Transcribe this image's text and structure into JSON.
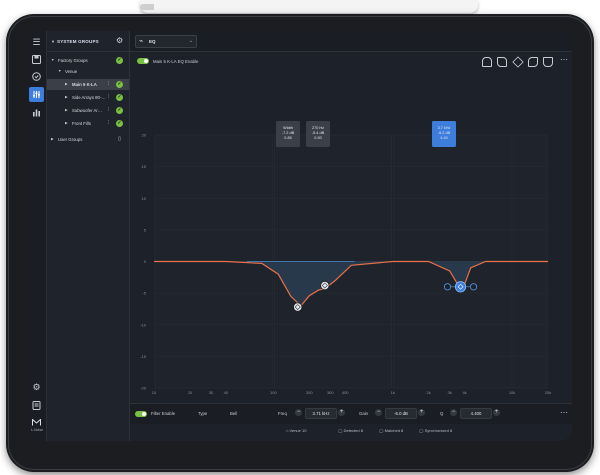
{
  "rail": {
    "bottom_label": "L-Noise"
  },
  "groups_panel": {
    "title": "SYSTEM GROUPS",
    "items": [
      {
        "label": "Factory Groups",
        "indent": 0,
        "expanded": true
      },
      {
        "label": "Venue",
        "indent": 1,
        "expanded": true
      },
      {
        "label": "Main 5 K-LA",
        "indent": 2,
        "selected": true
      },
      {
        "label": "Side Arrays 80-…",
        "indent": 2
      },
      {
        "label": "Subwoofer Ar…",
        "indent": 2
      },
      {
        "label": "Front Fills",
        "indent": 2
      },
      {
        "label": "User Groups",
        "indent": 0
      }
    ]
  },
  "topbar": {
    "selector_label": "EQ"
  },
  "eq_toggle_label": "Main 5 K-LA  EQ Enable",
  "filter_tags": [
    {
      "line1": "Width",
      "line2": "-7.2 dB",
      "line3": "0.85"
    },
    {
      "line1": "270 Hz",
      "line2": "-5.4 dB",
      "line3": "0.50"
    },
    {
      "line1": "3.7 kHz",
      "line2": "-6.2 dB",
      "line3": "4.40"
    }
  ],
  "chart_data": {
    "type": "line",
    "x_ticks": [
      "10",
      "20",
      "30",
      "40",
      "100",
      "200",
      "300",
      "400",
      "1k",
      "2k",
      "3k",
      "4k",
      "10k",
      "20k"
    ],
    "y_ticks": [
      "20",
      "15",
      "10",
      "5",
      "0",
      "-5",
      "-10",
      "-15",
      "-20"
    ],
    "xlim": [
      10,
      20000
    ],
    "ylim": [
      -20,
      20
    ],
    "x_scale": "log",
    "grid": true,
    "series": [
      {
        "color": "#e8704a",
        "x": [
          10,
          40,
          80,
          110,
          140,
          170,
          200,
          240,
          270,
          330,
          450,
          1000,
          2000,
          3000,
          3500,
          3700,
          4000,
          4500,
          6000,
          10000,
          20000
        ],
        "y": [
          0,
          0,
          -0.3,
          -2,
          -5.5,
          -7,
          -5.4,
          -4.5,
          -4.3,
          -3,
          -0.6,
          0,
          0,
          -1.5,
          -3.6,
          -4.1,
          -3.6,
          -1,
          0,
          0,
          0
        ]
      }
    ],
    "filter_points": [
      {
        "freq": 160,
        "gain": -7.2
      },
      {
        "freq": 270,
        "gain": -3.8
      },
      {
        "freq": 3700,
        "gain": -4.0
      }
    ]
  },
  "filter_bar": {
    "enable_label": "Filter Enable",
    "type_label": "Type",
    "type_value": "Bell",
    "freq_label": "Freq",
    "freq_value": "3.71 kHz",
    "gain_label": "Gain",
    "gain_value": "-6.0 dB",
    "q_label": "Q",
    "q_value": "4.400"
  },
  "status_bar": [
    {
      "icon": "venue-icon",
      "label": "Venue 10"
    },
    {
      "icon": "check-icon",
      "label": "Detected 8"
    },
    {
      "icon": "check-icon",
      "label": "Matched 8"
    },
    {
      "icon": "check-icon",
      "label": "Synchronized 8"
    }
  ],
  "colors": {
    "accent": "#3d7ddb",
    "enabled": "#7bc043",
    "curve": "#e8704a",
    "fill": "#2d4a66"
  }
}
